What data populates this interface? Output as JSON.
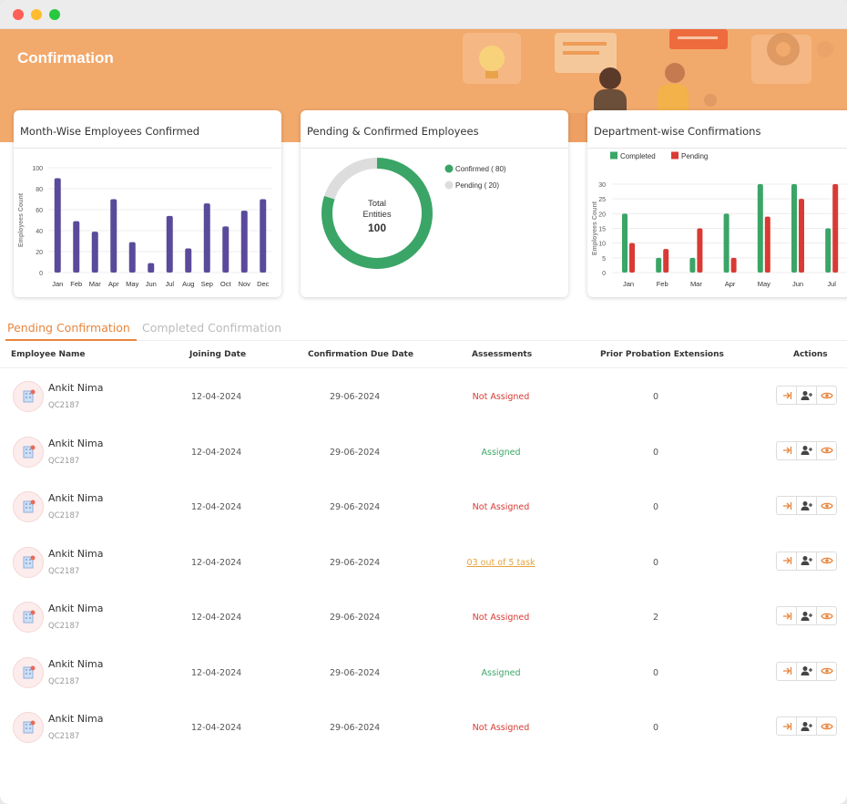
{
  "header": {
    "title": "Confirmation"
  },
  "colors": {
    "accent": "#e8853d",
    "bar_purple": "#5a4a9a",
    "green": "#3aa566",
    "red": "#d93a34",
    "ring_grey": "#dddddd"
  },
  "chart_data": [
    {
      "type": "bar",
      "title": "Month-Wise Employees Confirmed",
      "ylabel": "Employees Count",
      "categories": [
        "Jan",
        "Feb",
        "Mar",
        "Apr",
        "May",
        "Jun",
        "Jul",
        "Aug",
        "Sep",
        "Oct",
        "Nov",
        "Dec"
      ],
      "values": [
        90,
        49,
        39,
        70,
        29,
        9,
        54,
        23,
        66,
        44,
        59,
        70
      ],
      "ylim": [
        0,
        100
      ],
      "yticks": [
        0,
        20,
        40,
        60,
        80,
        100
      ]
    },
    {
      "type": "pie",
      "title": "Pending & Confirmed Employees",
      "center_label": "Total Entities",
      "center_value": "100",
      "slices": [
        {
          "name": "Confirmed ( 80)",
          "value": 80,
          "color": "#3aa566"
        },
        {
          "name": "Pending ( 20)",
          "value": 20,
          "color": "#dddddd"
        }
      ]
    },
    {
      "type": "bar",
      "title": "Department-wise Confirmations",
      "ylabel": "Employees Count",
      "categories": [
        "Jan",
        "Feb",
        "Mar",
        "Apr",
        "May",
        "Jun",
        "Jul"
      ],
      "series": [
        {
          "name": "Completed",
          "color": "#3aa566",
          "values": [
            20,
            5,
            5,
            20,
            30,
            30,
            15
          ]
        },
        {
          "name": "Pending",
          "color": "#d93a34",
          "values": [
            10,
            8,
            15,
            5,
            19,
            25,
            30
          ]
        }
      ],
      "ylim": [
        0,
        30
      ],
      "yticks": [
        0,
        5,
        10,
        15,
        20,
        25,
        30
      ]
    }
  ],
  "tabs": {
    "active": "Pending Confirmation",
    "inactive": "Completed Confirmation"
  },
  "table": {
    "columns": [
      "Employee Name",
      "Joining Date",
      "Confirmation Due Date",
      "Assessments",
      "Prior Probation Extensions",
      "Actions"
    ],
    "rows": [
      {
        "name": "Ankit Nima",
        "id": "QC2187",
        "joining": "12-04-2024",
        "due": "29-06-2024",
        "assessment": "Not Assigned",
        "status": "red",
        "extensions": "0"
      },
      {
        "name": "Ankit Nima",
        "id": "QC2187",
        "joining": "12-04-2024",
        "due": "29-06-2024",
        "assessment": "Assigned",
        "status": "green",
        "extensions": "0"
      },
      {
        "name": "Ankit Nima",
        "id": "QC2187",
        "joining": "12-04-2024",
        "due": "29-06-2024",
        "assessment": "Not Assigned",
        "status": "red",
        "extensions": "0"
      },
      {
        "name": "Ankit Nima",
        "id": "QC2187",
        "joining": "12-04-2024",
        "due": "29-06-2024",
        "assessment": "03 out of 5 task",
        "status": "link",
        "extensions": "0"
      },
      {
        "name": "Ankit Nima",
        "id": "QC2187",
        "joining": "12-04-2024",
        "due": "29-06-2024",
        "assessment": "Not Assigned",
        "status": "red",
        "extensions": "2"
      },
      {
        "name": "Ankit Nima",
        "id": "QC2187",
        "joining": "12-04-2024",
        "due": "29-06-2024",
        "assessment": "Assigned",
        "status": "green",
        "extensions": "0"
      },
      {
        "name": "Ankit Nima",
        "id": "QC2187",
        "joining": "12-04-2024",
        "due": "29-06-2024",
        "assessment": "Not Assigned",
        "status": "red",
        "extensions": "0"
      }
    ]
  }
}
